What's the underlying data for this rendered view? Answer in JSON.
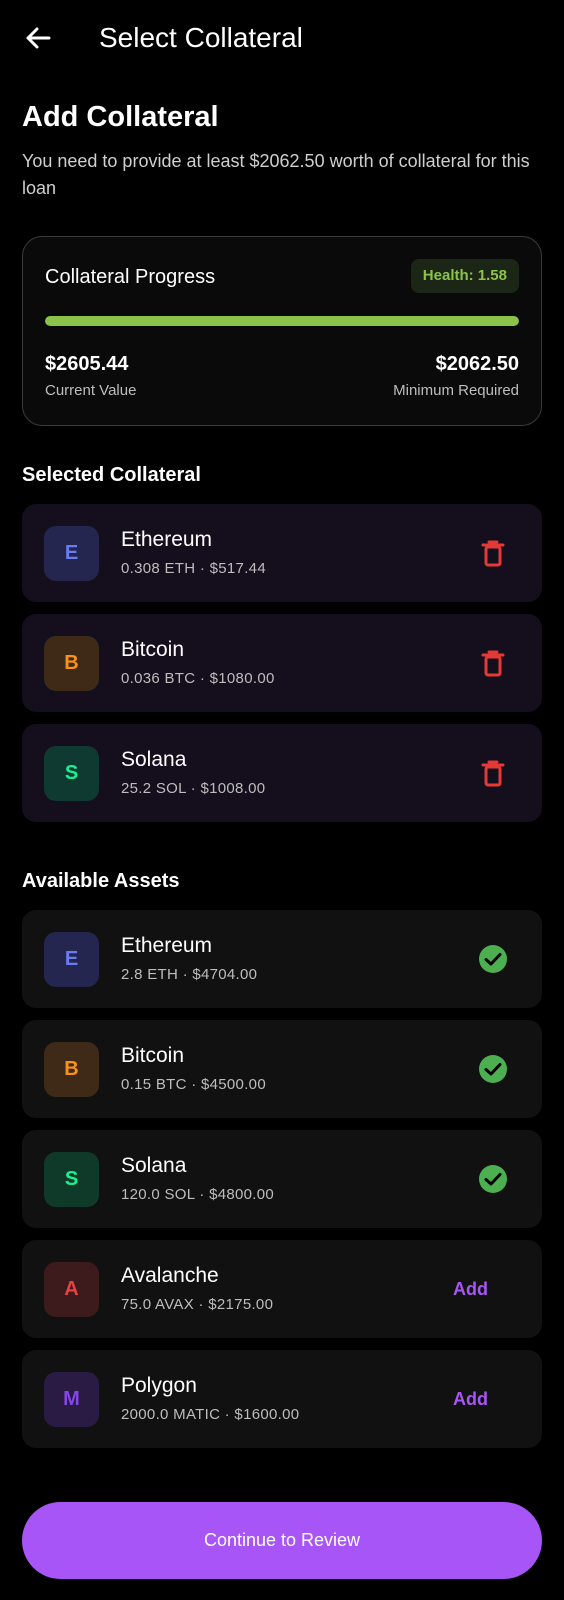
{
  "header": {
    "title": "Select Collateral",
    "back_icon": "arrow-left-icon"
  },
  "intro": {
    "heading": "Add Collateral",
    "description": "You need to provide at least $2062.50 worth of collateral for this loan"
  },
  "progress": {
    "title": "Collateral Progress",
    "health_label": "Health: 1.58",
    "fill_percent": 100,
    "current_value": "$2605.44",
    "current_label": "Current Value",
    "minimum_value": "$2062.50",
    "minimum_label": "Minimum Required",
    "bar_color": "#8bc34a"
  },
  "selected": {
    "title": "Selected Collateral",
    "items": [
      {
        "letter": "E",
        "name": "Ethereum",
        "detail": "0.308 ETH · $517.44",
        "action_icon": "trash-icon"
      },
      {
        "letter": "B",
        "name": "Bitcoin",
        "detail": "0.036 BTC · $1080.00",
        "action_icon": "trash-icon"
      },
      {
        "letter": "S",
        "name": "Solana",
        "detail": "25.2 SOL · $1008.00",
        "action_icon": "trash-icon"
      }
    ]
  },
  "available": {
    "title": "Available Assets",
    "items": [
      {
        "letter": "E",
        "name": "Ethereum",
        "detail": "2.8 ETH · $4704.00",
        "status": "selected",
        "action_icon": "check-circle-icon"
      },
      {
        "letter": "B",
        "name": "Bitcoin",
        "detail": "0.15 BTC · $4500.00",
        "status": "selected",
        "action_icon": "check-circle-icon"
      },
      {
        "letter": "S",
        "name": "Solana",
        "detail": "120.0 SOL · $4800.00",
        "status": "selected",
        "action_icon": "check-circle-icon"
      },
      {
        "letter": "A",
        "name": "Avalanche",
        "detail": "75.0 AVAX · $2175.00",
        "status": "add",
        "add_label": "Add"
      },
      {
        "letter": "M",
        "name": "Polygon",
        "detail": "2000.0 MATIC · $1600.00",
        "status": "add",
        "add_label": "Add"
      }
    ]
  },
  "colors": {
    "accent": "#a855f7",
    "danger": "#e53935",
    "success": "#4caf50",
    "eth": "#6b7cf0",
    "btc": "#f7931a",
    "sol": "#14f195",
    "avax": "#e84142",
    "matic": "#8247e5"
  },
  "footer": {
    "continue_label": "Continue to Review"
  }
}
